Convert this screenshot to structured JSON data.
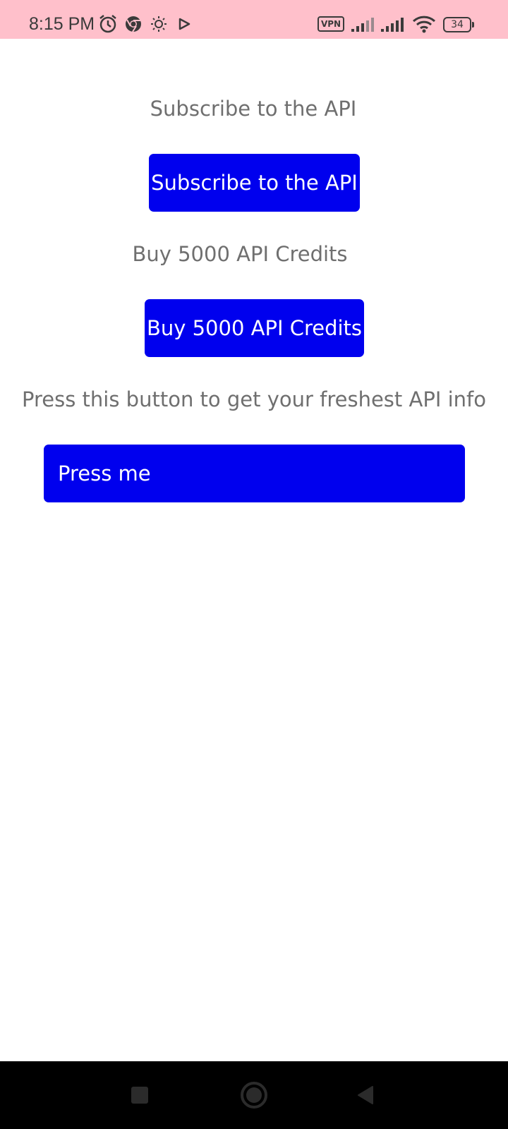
{
  "status_bar": {
    "time": "8:15 PM",
    "vpn": "VPN",
    "battery": "34",
    "icons": [
      "alarm-icon",
      "chrome-icon",
      "brightness-icon",
      "play-icon",
      "signal-icon",
      "signal-icon",
      "wifi-icon",
      "battery-icon"
    ]
  },
  "main": {
    "subscribe_label": "Subscribe to the API",
    "subscribe_button": "Subscribe to the API",
    "buy_label": "Buy 5000 API Credits",
    "buy_button": "Buy 5000 API Credits",
    "info_label": "Press this button to get your freshest API info",
    "press_button": "Press me"
  },
  "colors": {
    "status_bar": "#ffc0cb",
    "button": "#0000ee",
    "label_text": "#6f6f6f",
    "nav_bar": "#000000"
  },
  "nav_bar": {
    "buttons": [
      "recent-apps-icon",
      "home-icon",
      "back-icon"
    ]
  }
}
